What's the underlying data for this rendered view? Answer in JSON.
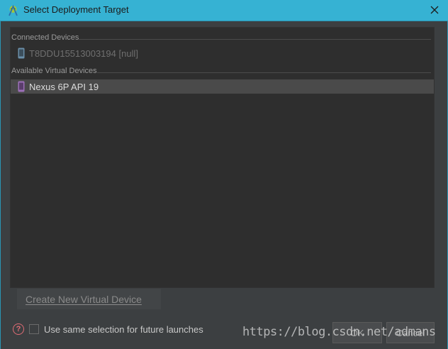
{
  "window": {
    "title": "Select Deployment Target",
    "close_icon": "close-icon",
    "app_icon": "android-studio-icon"
  },
  "connected": {
    "header": "Connected Devices",
    "devices": [
      {
        "label": "T8DDU15513003194 [null]",
        "icon": "phone-icon",
        "enabled": false
      }
    ]
  },
  "virtual": {
    "header": "Available Virtual Devices",
    "devices": [
      {
        "label": "Nexus 6P API 19",
        "icon": "phone-icon",
        "selected": true
      }
    ]
  },
  "create_button": {
    "label": "Create New Virtual Device"
  },
  "footer": {
    "help_icon": "help-icon",
    "checkbox_label": "Use same selection for future launches",
    "checkbox_checked": false,
    "ok_label": "OK",
    "cancel_label": "Cancel"
  },
  "watermark": "https://blog.csdn.net/admans",
  "colors": {
    "titlebar": "#36b2d3",
    "dialog_bg": "#3c3f41",
    "list_bg": "#2e2e2e",
    "selection": "#4a4a4a",
    "help_icon": "#e06c75",
    "device_icon_virtual": "#9c6fb8",
    "device_icon_physical": "#6a8ea8"
  }
}
